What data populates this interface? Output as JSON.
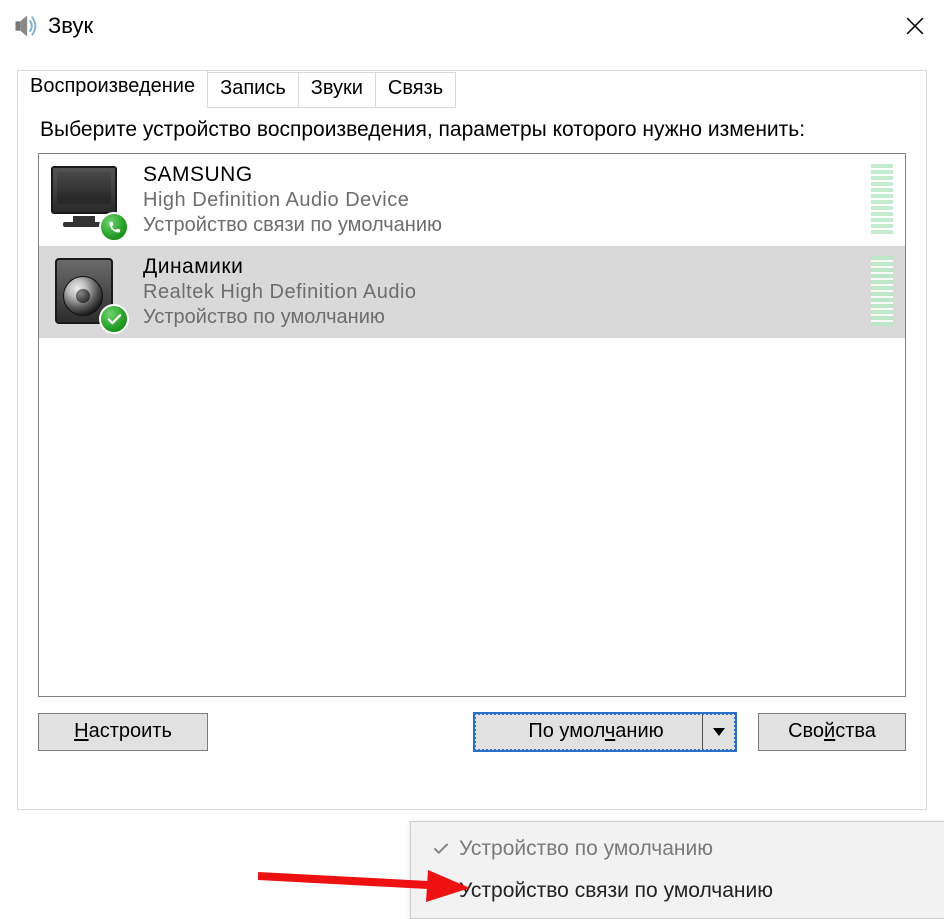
{
  "window": {
    "title": "Звук"
  },
  "tabs": [
    "Воспроизведение",
    "Запись",
    "Звуки",
    "Связь"
  ],
  "active_tab_index": 0,
  "instruction": "Выберите устройство воспроизведения, параметры которого нужно изменить:",
  "devices": [
    {
      "name": "SAMSUNG",
      "subtitle": "High Definition Audio Device",
      "status": "Устройство связи по умолчанию",
      "icon": "monitor",
      "badge": "phone",
      "selected": false
    },
    {
      "name": "Динамики",
      "subtitle": "Realtek High Definition Audio",
      "status": "Устройство по умолчанию",
      "icon": "speaker",
      "badge": "check",
      "selected": true
    }
  ],
  "buttons": {
    "configure": "Настроить",
    "default": "По умолчанию",
    "properties": "Свойства"
  },
  "dropdown": {
    "items": [
      {
        "label": "Устройство по умолчанию",
        "checked": true,
        "disabled": true
      },
      {
        "label": "Устройство связи по умолчанию",
        "checked": false,
        "disabled": false
      }
    ]
  },
  "underline_chars": {
    "configure": "Н",
    "default": "ч",
    "properties": "й"
  }
}
